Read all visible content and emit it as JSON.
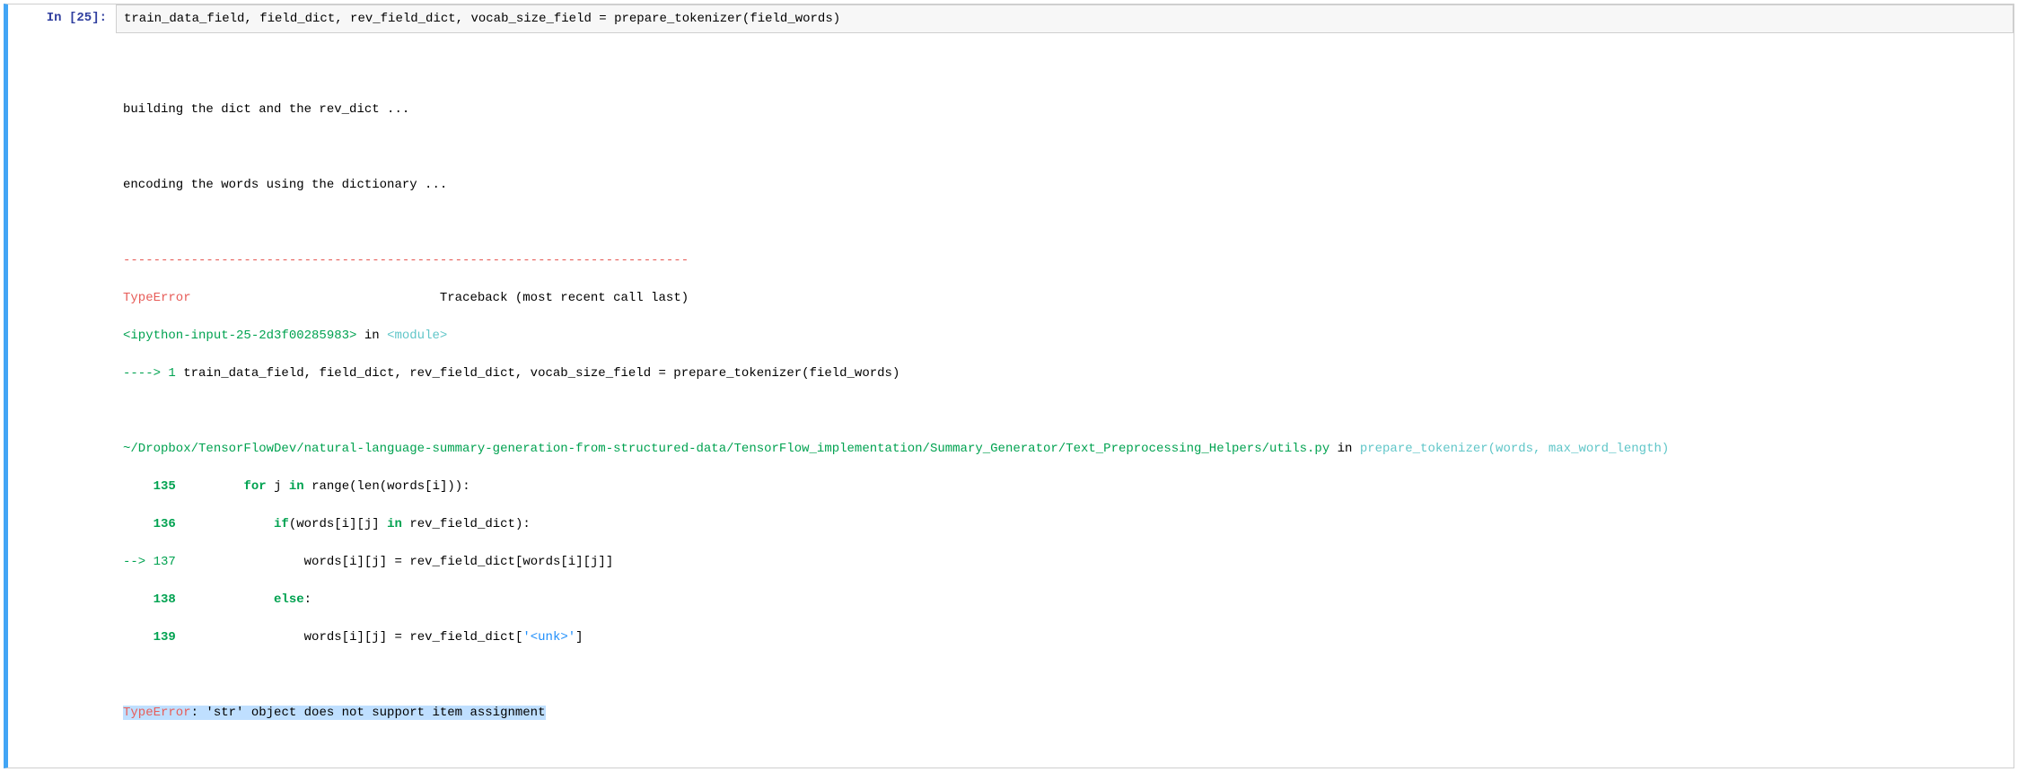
{
  "prompt": {
    "label": "In [25]:"
  },
  "input": {
    "code": "train_data_field, field_dict, rev_field_dict, vocab_size_field = prepare_tokenizer(field_words)"
  },
  "output": {
    "stdout1": "building the dict and the rev_dict ...",
    "stdout2": "encoding the words using the dictionary ...",
    "hr": "---------------------------------------------------------------------------",
    "err_name": "TypeError",
    "err_tb": "                                 Traceback (most recent call last)",
    "ipyinput": "<ipython-input-25-2d3f00285983>",
    "in_word": " in ",
    "module_tag": "<module>",
    "arrow1": "----> 1",
    "arrow1_code": " train_data_field, field_dict, rev_field_dict, vocab_size_field = prepare_tokenizer(field_words)",
    "file_path": "~/Dropbox/TensorFlowDev/natural-language-summary-generation-from-structured-data/TensorFlow_implementation/Summary_Generator/Text_Preprocessing_Helpers/utils.py",
    "func_sig": "prepare_tokenizer(words, max_word_length)",
    "l135_num": "    135",
    "l135_a": "         for",
    "l135_b": " j ",
    "l135_c": "in",
    "l135_d": " range(len(words[i])):",
    "l135_idx_open": "[",
    "l135_idx_i": "i",
    "l135_idx_close": "]",
    "l136_num": "    136",
    "l136_a": "             if",
    "l136_b": "(words[i][j] ",
    "l136_c": "in",
    "l136_d": " rev_field_dict):",
    "l137_arrow": "--> ",
    "l137_num": "137",
    "l137_a": "                 words[i][j] = rev_field_dict[words[i][j]]",
    "l138_num": "    138",
    "l138_a": "             else",
    "l138_b": ":",
    "l139_num": "    139",
    "l139_a": "                 words[i][j] = rev_field_dict[",
    "l139_str": "'<unk>'",
    "l139_b": "]",
    "final_err": "TypeError",
    "final_msg": ": 'str' object does not support item assignment",
    "code_bits": {
      "for": "for",
      "in": "in",
      "if": "if",
      "else": "else",
      "range": "range",
      "len": "len",
      "words": "words",
      "rev_field_dict": "rev_field_dict",
      "paren_o": "(",
      "paren_c": ")",
      "brack_o": "[",
      "brack_c": "]",
      "i": "i",
      "j": "j",
      "colon": ":",
      "eq": " = ",
      "sp": " ",
      "unk": "'<unk>'"
    }
  }
}
